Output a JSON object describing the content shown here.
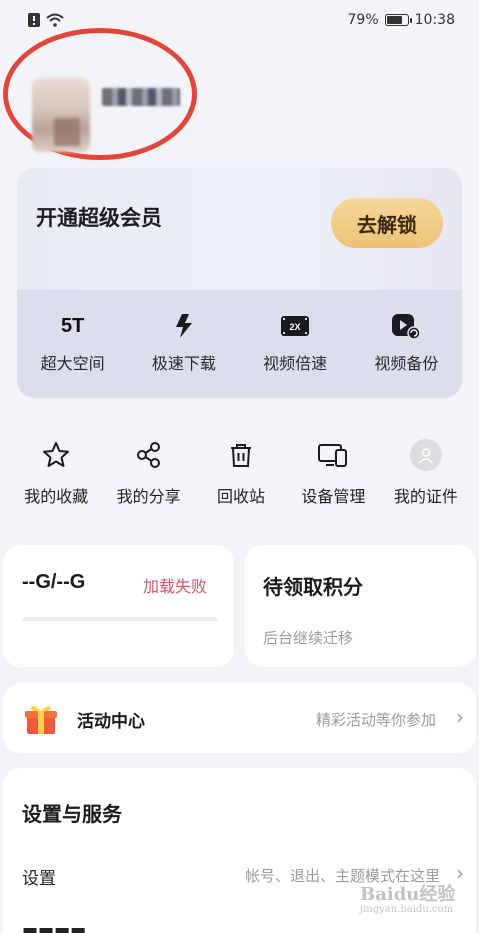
{
  "status_bar": {
    "battery": "79%",
    "time": "10:38",
    "battery_level": 0.79
  },
  "vip": {
    "title": "开通超级会员",
    "unlock_label": "去解锁",
    "features": [
      {
        "icon": "5T",
        "label": "超大空间"
      },
      {
        "icon": "lightning-icon",
        "label": "极速下载"
      },
      {
        "icon": "2x-speed-icon",
        "label": "视频倍速"
      },
      {
        "icon": "video-backup-icon",
        "label": "视频备份"
      }
    ]
  },
  "quick_actions": [
    {
      "icon": "star-icon",
      "label": "我的收藏"
    },
    {
      "icon": "share-icon",
      "label": "我的分享"
    },
    {
      "icon": "trash-icon",
      "label": "回收站"
    },
    {
      "icon": "devices-icon",
      "label": "设备管理"
    },
    {
      "icon": "avatar-icon",
      "label": "我的证件"
    }
  ],
  "storage": {
    "value": "--G/--G",
    "error": "加载失败"
  },
  "points": {
    "title": "待领取积分",
    "subtitle": "后台继续迁移"
  },
  "activity": {
    "title": "活动中心",
    "subtitle": "精彩活动等你参加"
  },
  "settings": {
    "title": "设置与服务",
    "row1_label": "设置",
    "row1_sub": "帐号、退出、主题模式在这里"
  },
  "watermark": {
    "main": "Baidu经验",
    "sub": "jingyan.baidu.com"
  },
  "colors": {
    "accent_error": "#d4566c",
    "unlock_gold": "#ecc277",
    "annotation_red": "#e2463b"
  }
}
